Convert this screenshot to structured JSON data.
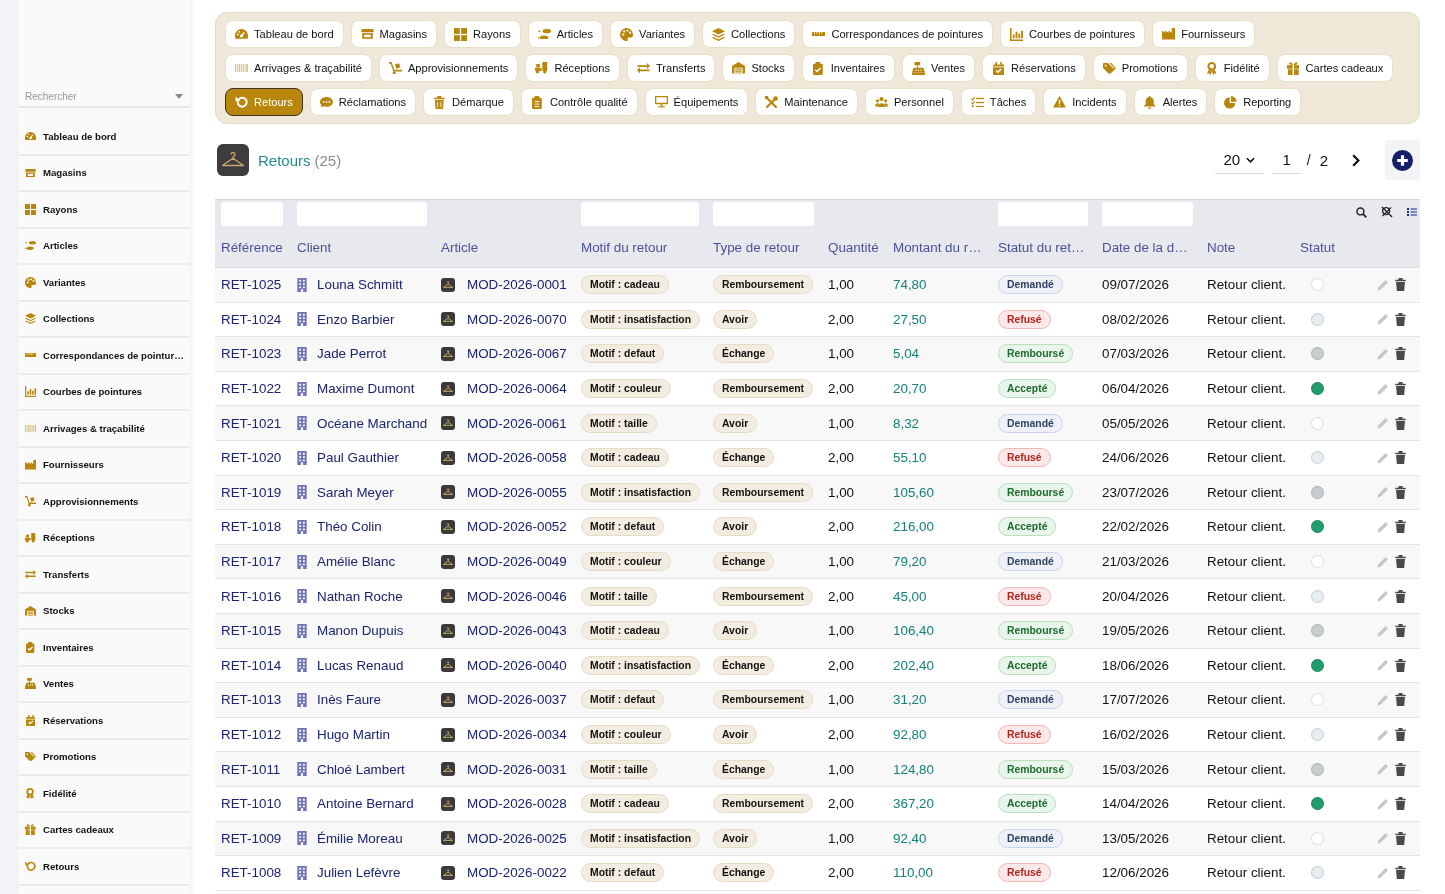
{
  "sidebar": {
    "search": {
      "placeholder": "Rechercher"
    },
    "items": [
      "Tableau de bord",
      "Magasins",
      "Rayons",
      "Articles",
      "Variantes",
      "Collections",
      "Correspondances de pointur…",
      "Courbes de pointures",
      "Arrivages & traçabilité",
      "Fournisseurs",
      "Approvisionnements",
      "Réceptions",
      "Transferts",
      "Stocks",
      "Inventaires",
      "Ventes",
      "Réservations",
      "Promotions",
      "Fidélité",
      "Cartes cadeaux",
      "Retours"
    ]
  },
  "nav": {
    "tabs": [
      {
        "label": "Tableau de bord",
        "selected": false
      },
      {
        "label": "Magasins",
        "selected": false
      },
      {
        "label": "Rayons",
        "selected": false
      },
      {
        "label": "Articles",
        "selected": false
      },
      {
        "label": "Variantes",
        "selected": false
      },
      {
        "label": "Collections",
        "selected": false
      },
      {
        "label": "Correspondances de pointures",
        "selected": false
      },
      {
        "label": "Courbes de pointures",
        "selected": false
      },
      {
        "label": "Fournisseurs",
        "selected": false
      },
      {
        "label": "Arrivages & traçabilité",
        "selected": false
      },
      {
        "label": "Approvisionnements",
        "selected": false
      },
      {
        "label": "Réceptions",
        "selected": false
      },
      {
        "label": "Transferts",
        "selected": false
      },
      {
        "label": "Stocks",
        "selected": false
      },
      {
        "label": "Inventaires",
        "selected": false
      },
      {
        "label": "Ventes",
        "selected": false
      },
      {
        "label": "Réservations",
        "selected": false
      },
      {
        "label": "Promotions",
        "selected": false
      },
      {
        "label": "Fidélité",
        "selected": false
      },
      {
        "label": "Cartes cadeaux",
        "selected": false
      },
      {
        "label": "Retours",
        "selected": true
      },
      {
        "label": "Réclamations",
        "selected": false
      },
      {
        "label": "Démarque",
        "selected": false
      },
      {
        "label": "Contrôle qualité",
        "selected": false
      },
      {
        "label": "Équipements",
        "selected": false
      },
      {
        "label": "Maintenance",
        "selected": false
      },
      {
        "label": "Personnel",
        "selected": false
      },
      {
        "label": "Tâches",
        "selected": false
      },
      {
        "label": "Incidents",
        "selected": false
      },
      {
        "label": "Alertes",
        "selected": false
      },
      {
        "label": "Reporting",
        "selected": false
      }
    ]
  },
  "header": {
    "title": "Retours",
    "count": "(25)",
    "page_size": "20",
    "page": "1",
    "separator": "/",
    "page_count": "2"
  },
  "table": {
    "columns": [
      {
        "label": "Référence",
        "filter": true
      },
      {
        "label": "Client",
        "filter": true
      },
      {
        "label": "Article",
        "filter": false
      },
      {
        "label": "Motif du retour",
        "filter": true
      },
      {
        "label": "Type de retour",
        "filter": true
      },
      {
        "label": "Quantité",
        "filter": false
      },
      {
        "label": "Montant du r…",
        "filter": false
      },
      {
        "label": "Statut du ret…",
        "filter": true
      },
      {
        "label": "Date de la d…",
        "filter": true
      },
      {
        "label": "Note",
        "filter": false
      },
      {
        "label": "Statut",
        "filter": false
      }
    ],
    "rows": [
      {
        "reference": "RET-1025",
        "client": "Louna Schmitt",
        "article": "MOD-2026-0001",
        "motif": "Motif : cadeau",
        "type": "Remboursement",
        "quantite": "1,00",
        "montant": "74,80",
        "statut_retour": {
          "label": "Demandé",
          "kind": "requested"
        },
        "date": "09/07/2026",
        "note": "Retour client.",
        "statut": {
          "color": "#ffffff"
        }
      },
      {
        "reference": "RET-1024",
        "client": "Enzo Barbier",
        "article": "MOD-2026-0070",
        "motif": "Motif : insatisfaction",
        "type": "Avoir",
        "quantite": "2,00",
        "montant": "27,50",
        "statut_retour": {
          "label": "Refusé",
          "kind": "refused"
        },
        "date": "08/02/2026",
        "note": "Retour client.",
        "statut": {
          "color": "#e5eef0"
        }
      },
      {
        "reference": "RET-1023",
        "client": "Jade Perrot",
        "article": "MOD-2026-0067",
        "motif": "Motif : defaut",
        "type": "Échange",
        "quantite": "1,00",
        "montant": "5,04",
        "statut_retour": {
          "label": "Remboursé",
          "kind": "refunded"
        },
        "date": "07/03/2026",
        "note": "Retour client.",
        "statut": {
          "color": "#c6cecf"
        }
      },
      {
        "reference": "RET-1022",
        "client": "Maxime Dumont",
        "article": "MOD-2026-0064",
        "motif": "Motif : couleur",
        "type": "Remboursement",
        "quantite": "2,00",
        "montant": "20,70",
        "statut_retour": {
          "label": "Accepté",
          "kind": "accepted"
        },
        "date": "06/04/2026",
        "note": "Retour client.",
        "statut": {
          "color": "#1f9d6c"
        }
      },
      {
        "reference": "RET-1021",
        "client": "Océane Marchand",
        "article": "MOD-2026-0061",
        "motif": "Motif : taille",
        "type": "Avoir",
        "quantite": "1,00",
        "montant": "8,32",
        "statut_retour": {
          "label": "Demandé",
          "kind": "requested"
        },
        "date": "05/05/2026",
        "note": "Retour client.",
        "statut": {
          "color": "#ffffff"
        }
      },
      {
        "reference": "RET-1020",
        "client": "Paul Gauthier",
        "article": "MOD-2026-0058",
        "motif": "Motif : cadeau",
        "type": "Échange",
        "quantite": "2,00",
        "montant": "55,10",
        "statut_retour": {
          "label": "Refusé",
          "kind": "refused"
        },
        "date": "24/06/2026",
        "note": "Retour client.",
        "statut": {
          "color": "#e5eef0"
        }
      },
      {
        "reference": "RET-1019",
        "client": "Sarah Meyer",
        "article": "MOD-2026-0055",
        "motif": "Motif : insatisfaction",
        "type": "Remboursement",
        "quantite": "1,00",
        "montant": "105,60",
        "statut_retour": {
          "label": "Remboursé",
          "kind": "refunded"
        },
        "date": "23/07/2026",
        "note": "Retour client.",
        "statut": {
          "color": "#c6cecf"
        }
      },
      {
        "reference": "RET-1018",
        "client": "Théo Colin",
        "article": "MOD-2026-0052",
        "motif": "Motif : defaut",
        "type": "Avoir",
        "quantite": "2,00",
        "montant": "216,00",
        "statut_retour": {
          "label": "Accepté",
          "kind": "accepted"
        },
        "date": "22/02/2026",
        "note": "Retour client.",
        "statut": {
          "color": "#1f9d6c"
        }
      },
      {
        "reference": "RET-1017",
        "client": "Amélie Blanc",
        "article": "MOD-2026-0049",
        "motif": "Motif : couleur",
        "type": "Échange",
        "quantite": "1,00",
        "montant": "79,20",
        "statut_retour": {
          "label": "Demandé",
          "kind": "requested"
        },
        "date": "21/03/2026",
        "note": "Retour client.",
        "statut": {
          "color": "#ffffff"
        }
      },
      {
        "reference": "RET-1016",
        "client": "Nathan Roche",
        "article": "MOD-2026-0046",
        "motif": "Motif : taille",
        "type": "Remboursement",
        "quantite": "2,00",
        "montant": "45,00",
        "statut_retour": {
          "label": "Refusé",
          "kind": "refused"
        },
        "date": "20/04/2026",
        "note": "Retour client.",
        "statut": {
          "color": "#e5eef0"
        }
      },
      {
        "reference": "RET-1015",
        "client": "Manon Dupuis",
        "article": "MOD-2026-0043",
        "motif": "Motif : cadeau",
        "type": "Avoir",
        "quantite": "1,00",
        "montant": "106,40",
        "statut_retour": {
          "label": "Remboursé",
          "kind": "refunded"
        },
        "date": "19/05/2026",
        "note": "Retour client.",
        "statut": {
          "color": "#c6cecf"
        }
      },
      {
        "reference": "RET-1014",
        "client": "Lucas Renaud",
        "article": "MOD-2026-0040",
        "motif": "Motif : insatisfaction",
        "type": "Échange",
        "quantite": "2,00",
        "montant": "202,40",
        "statut_retour": {
          "label": "Accepté",
          "kind": "accepted"
        },
        "date": "18/06/2026",
        "note": "Retour client.",
        "statut": {
          "color": "#1f9d6c"
        }
      },
      {
        "reference": "RET-1013",
        "client": "Inès Faure",
        "article": "MOD-2026-0037",
        "motif": "Motif : defaut",
        "type": "Remboursement",
        "quantite": "1,00",
        "montant": "31,20",
        "statut_retour": {
          "label": "Demandé",
          "kind": "requested"
        },
        "date": "17/07/2026",
        "note": "Retour client.",
        "statut": {
          "color": "#ffffff"
        }
      },
      {
        "reference": "RET-1012",
        "client": "Hugo Martin",
        "article": "MOD-2026-0034",
        "motif": "Motif : couleur",
        "type": "Avoir",
        "quantite": "2,00",
        "montant": "92,80",
        "statut_retour": {
          "label": "Refusé",
          "kind": "refused"
        },
        "date": "16/02/2026",
        "note": "Retour client.",
        "statut": {
          "color": "#e5eef0"
        }
      },
      {
        "reference": "RET-1011",
        "client": "Chloé Lambert",
        "article": "MOD-2026-0031",
        "motif": "Motif : taille",
        "type": "Échange",
        "quantite": "1,00",
        "montant": "124,80",
        "statut_retour": {
          "label": "Remboursé",
          "kind": "refunded"
        },
        "date": "15/03/2026",
        "note": "Retour client.",
        "statut": {
          "color": "#c6cecf"
        }
      },
      {
        "reference": "RET-1010",
        "client": "Antoine Bernard",
        "article": "MOD-2026-0028",
        "motif": "Motif : cadeau",
        "type": "Remboursement",
        "quantite": "2,00",
        "montant": "367,20",
        "statut_retour": {
          "label": "Accepté",
          "kind": "accepted"
        },
        "date": "14/04/2026",
        "note": "Retour client.",
        "statut": {
          "color": "#1f9d6c"
        }
      },
      {
        "reference": "RET-1009",
        "client": "Émilie Moreau",
        "article": "MOD-2026-0025",
        "motif": "Motif : insatisfaction",
        "type": "Avoir",
        "quantite": "1,00",
        "montant": "92,40",
        "statut_retour": {
          "label": "Demandé",
          "kind": "requested"
        },
        "date": "13/05/2026",
        "note": "Retour client.",
        "statut": {
          "color": "#ffffff"
        }
      },
      {
        "reference": "RET-1008",
        "client": "Julien Lefèvre",
        "article": "MOD-2026-0022",
        "motif": "Motif : defaut",
        "type": "Échange",
        "quantite": "2,00",
        "montant": "110,00",
        "statut_retour": {
          "label": "Refusé",
          "kind": "refused"
        },
        "date": "12/06/2026",
        "note": "Retour client.",
        "statut": {
          "color": "#e5eef0"
        }
      }
    ]
  }
}
